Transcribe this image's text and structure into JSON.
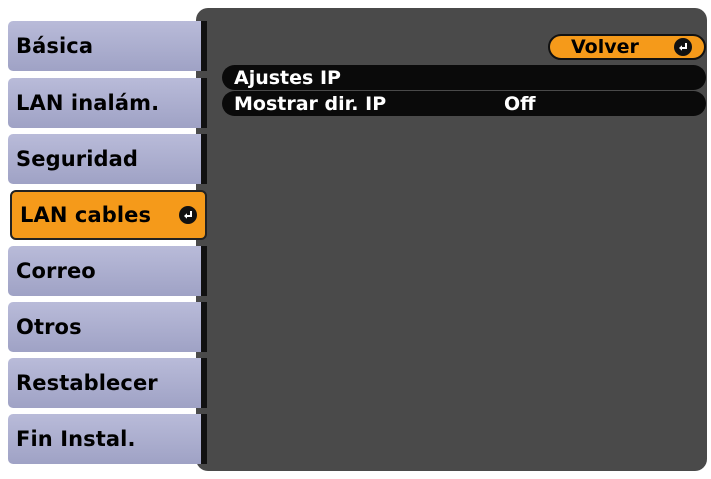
{
  "menu": {
    "items": [
      {
        "label": "Básica"
      },
      {
        "label": "LAN inalám."
      },
      {
        "label": "Seguridad"
      },
      {
        "label": "LAN cables",
        "selected": true
      },
      {
        "label": "Correo"
      },
      {
        "label": "Otros"
      },
      {
        "label": "Restablecer"
      },
      {
        "label": "Fin Instal."
      }
    ]
  },
  "panel": {
    "back_label": "Volver",
    "rows": [
      {
        "label": "Ajustes IP",
        "value": ""
      },
      {
        "label": "Mostrar dir. IP",
        "value": "Off"
      }
    ]
  },
  "colors": {
    "accent": "#f59a1a",
    "menu_item": "#aeb0d0",
    "panel_bg": "#4a4a4a",
    "row_bg": "#0a0a0a"
  },
  "icons": {
    "enter": "enter-return-icon"
  }
}
